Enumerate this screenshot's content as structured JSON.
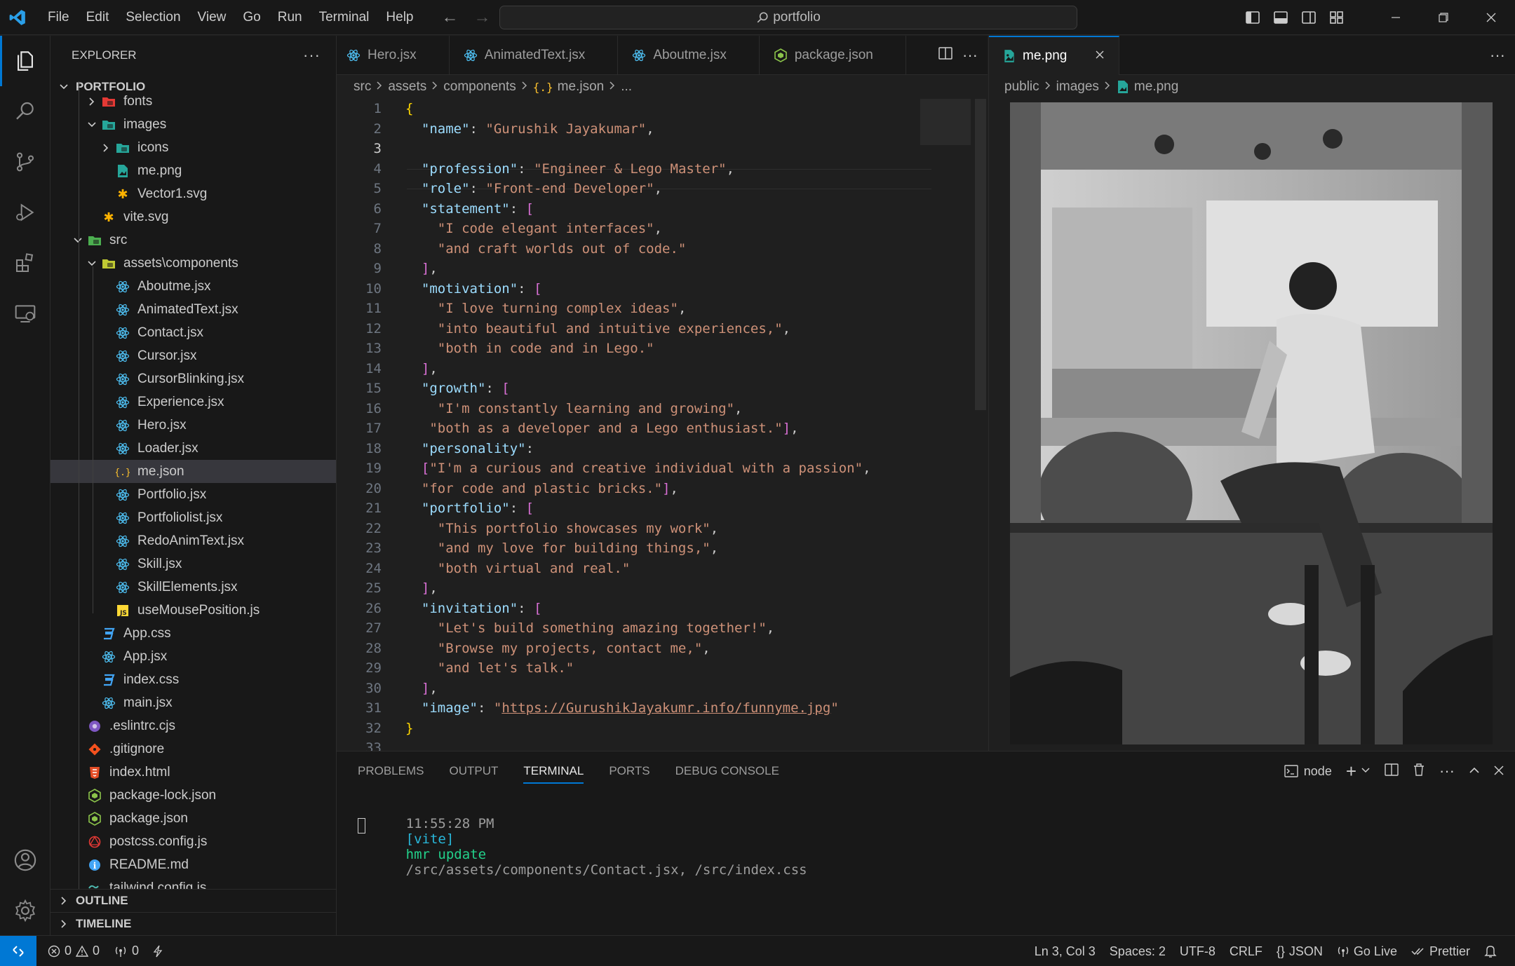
{
  "titlebar": {
    "menu": [
      "File",
      "Edit",
      "Selection",
      "View",
      "Go",
      "Run",
      "Terminal",
      "Help"
    ],
    "search": "portfolio"
  },
  "sidebar": {
    "header": "EXPLORER",
    "root": "PORTFOLIO",
    "items": [
      {
        "label": "fonts",
        "depth": 2,
        "type": "folder",
        "open": false,
        "icon": "folder-fonts-icon",
        "color": "#e53935"
      },
      {
        "label": "images",
        "depth": 2,
        "type": "folder",
        "open": true,
        "icon": "folder-images-icon",
        "color": "#26a69a"
      },
      {
        "label": "icons",
        "depth": 3,
        "type": "folder",
        "open": false,
        "icon": "folder-icons-icon",
        "color": "#26a69a"
      },
      {
        "label": "me.png",
        "depth": 3,
        "type": "file",
        "icon": "image-file-icon",
        "color": "#26a69a"
      },
      {
        "label": "Vector1.svg",
        "depth": 3,
        "type": "file",
        "icon": "svg-file-icon",
        "color": "#ffb300"
      },
      {
        "label": "vite.svg",
        "depth": 2,
        "type": "file",
        "icon": "svg-file-icon",
        "color": "#ffb300"
      },
      {
        "label": "src",
        "depth": 1,
        "type": "folder",
        "open": true,
        "icon": "folder-src-icon",
        "color": "#4caf50"
      },
      {
        "label": "assets\\components",
        "depth": 2,
        "type": "folder",
        "open": true,
        "icon": "folder-components-icon",
        "color": "#c0ca33"
      },
      {
        "label": "Aboutme.jsx",
        "depth": 3,
        "type": "file",
        "icon": "react-icon",
        "color": "#4fc3f7"
      },
      {
        "label": "AnimatedText.jsx",
        "depth": 3,
        "type": "file",
        "icon": "react-icon",
        "color": "#4fc3f7"
      },
      {
        "label": "Contact.jsx",
        "depth": 3,
        "type": "file",
        "icon": "react-icon",
        "color": "#4fc3f7"
      },
      {
        "label": "Cursor.jsx",
        "depth": 3,
        "type": "file",
        "icon": "react-icon",
        "color": "#4fc3f7"
      },
      {
        "label": "CursorBlinking.jsx",
        "depth": 3,
        "type": "file",
        "icon": "react-icon",
        "color": "#4fc3f7"
      },
      {
        "label": "Experience.jsx",
        "depth": 3,
        "type": "file",
        "icon": "react-icon",
        "color": "#4fc3f7"
      },
      {
        "label": "Hero.jsx",
        "depth": 3,
        "type": "file",
        "icon": "react-icon",
        "color": "#4fc3f7"
      },
      {
        "label": "Loader.jsx",
        "depth": 3,
        "type": "file",
        "icon": "react-icon",
        "color": "#4fc3f7"
      },
      {
        "label": "me.json",
        "depth": 3,
        "type": "file",
        "icon": "json-icon",
        "color": "#fbc02d",
        "selected": true
      },
      {
        "label": "Portfolio.jsx",
        "depth": 3,
        "type": "file",
        "icon": "react-icon",
        "color": "#4fc3f7"
      },
      {
        "label": "Portfoliolist.jsx",
        "depth": 3,
        "type": "file",
        "icon": "react-icon",
        "color": "#4fc3f7"
      },
      {
        "label": "RedoAnimText.jsx",
        "depth": 3,
        "type": "file",
        "icon": "react-icon",
        "color": "#4fc3f7"
      },
      {
        "label": "Skill.jsx",
        "depth": 3,
        "type": "file",
        "icon": "react-icon",
        "color": "#4fc3f7"
      },
      {
        "label": "SkillElements.jsx",
        "depth": 3,
        "type": "file",
        "icon": "react-icon",
        "color": "#4fc3f7"
      },
      {
        "label": "useMousePosition.js",
        "depth": 3,
        "type": "file",
        "icon": "js-icon",
        "color": "#fdd835"
      },
      {
        "label": "App.css",
        "depth": 2,
        "type": "file",
        "icon": "css-icon",
        "color": "#42a5f5"
      },
      {
        "label": "App.jsx",
        "depth": 2,
        "type": "file",
        "icon": "react-icon",
        "color": "#4fc3f7"
      },
      {
        "label": "index.css",
        "depth": 2,
        "type": "file",
        "icon": "css-icon",
        "color": "#42a5f5"
      },
      {
        "label": "main.jsx",
        "depth": 2,
        "type": "file",
        "icon": "react-icon",
        "color": "#4fc3f7"
      },
      {
        "label": ".eslintrc.cjs",
        "depth": 1,
        "type": "file",
        "icon": "eslint-icon",
        "color": "#7e57c2"
      },
      {
        "label": ".gitignore",
        "depth": 1,
        "type": "file",
        "icon": "git-icon",
        "color": "#f4511e"
      },
      {
        "label": "index.html",
        "depth": 1,
        "type": "file",
        "icon": "html-icon",
        "color": "#e44d26"
      },
      {
        "label": "package-lock.json",
        "depth": 1,
        "type": "file",
        "icon": "npm-icon",
        "color": "#8bc34a"
      },
      {
        "label": "package.json",
        "depth": 1,
        "type": "file",
        "icon": "npm-icon",
        "color": "#8bc34a"
      },
      {
        "label": "postcss.config.js",
        "depth": 1,
        "type": "file",
        "icon": "postcss-icon",
        "color": "#e53935"
      },
      {
        "label": "README.md",
        "depth": 1,
        "type": "file",
        "icon": "info-icon",
        "color": "#42a5f5"
      },
      {
        "label": "tailwind.config.js",
        "depth": 1,
        "type": "file",
        "icon": "tailwind-icon",
        "color": "#4db6ac"
      }
    ],
    "outline": "OUTLINE",
    "timeline": "TIMELINE"
  },
  "editor1": {
    "tabs": [
      {
        "label": "Hero.jsx",
        "icon": "react-icon",
        "color": "#4fc3f7",
        "active": false
      },
      {
        "label": "AnimatedText.jsx",
        "icon": "react-icon",
        "color": "#4fc3f7",
        "active": false
      },
      {
        "label": "Aboutme.jsx",
        "icon": "react-icon",
        "color": "#4fc3f7",
        "active": false
      },
      {
        "label": "package.json",
        "icon": "npm-icon",
        "color": "#8bc34a",
        "active": false
      }
    ],
    "breadcrumb": [
      "src",
      "assets",
      "components",
      "me.json",
      "..."
    ],
    "current_line": 3,
    "lines": [
      [
        [
          "b1",
          "{"
        ]
      ],
      [
        [
          "p",
          "  "
        ],
        [
          "k",
          "\"name\""
        ],
        [
          "p",
          ": "
        ],
        [
          "s",
          "\"Gurushik Jayakumar\""
        ],
        [
          "p",
          ","
        ]
      ],
      [],
      [
        [
          "p",
          "  "
        ],
        [
          "k",
          "\"profession\""
        ],
        [
          "p",
          ": "
        ],
        [
          "s",
          "\"Engineer & Lego Master\""
        ],
        [
          "p",
          ","
        ]
      ],
      [
        [
          "p",
          "  "
        ],
        [
          "k",
          "\"role\""
        ],
        [
          "p",
          ": "
        ],
        [
          "s",
          "\"Front-end Developer\""
        ],
        [
          "p",
          ","
        ]
      ],
      [
        [
          "p",
          "  "
        ],
        [
          "k",
          "\"statement\""
        ],
        [
          "p",
          ": "
        ],
        [
          "b2",
          "["
        ]
      ],
      [
        [
          "p",
          "    "
        ],
        [
          "s",
          "\"I code elegant interfaces\""
        ],
        [
          "p",
          ","
        ]
      ],
      [
        [
          "p",
          "    "
        ],
        [
          "s",
          "\"and craft worlds out of code.\""
        ]
      ],
      [
        [
          "p",
          "  "
        ],
        [
          "b2",
          "]"
        ],
        [
          "p",
          ","
        ]
      ],
      [
        [
          "p",
          "  "
        ],
        [
          "k",
          "\"motivation\""
        ],
        [
          "p",
          ": "
        ],
        [
          "b2",
          "["
        ]
      ],
      [
        [
          "p",
          "    "
        ],
        [
          "s",
          "\"I love turning complex ideas\""
        ],
        [
          "p",
          ","
        ]
      ],
      [
        [
          "p",
          "    "
        ],
        [
          "s",
          "\"into beautiful and intuitive experiences,\""
        ],
        [
          "p",
          ","
        ]
      ],
      [
        [
          "p",
          "    "
        ],
        [
          "s",
          "\"both in code and in Lego.\""
        ]
      ],
      [
        [
          "p",
          "  "
        ],
        [
          "b2",
          "]"
        ],
        [
          "p",
          ","
        ]
      ],
      [
        [
          "p",
          "  "
        ],
        [
          "k",
          "\"growth\""
        ],
        [
          "p",
          ": "
        ],
        [
          "b2",
          "["
        ]
      ],
      [
        [
          "p",
          "    "
        ],
        [
          "s",
          "\"I'm constantly learning and growing\""
        ],
        [
          "p",
          ","
        ]
      ],
      [
        [
          "p",
          "   "
        ],
        [
          "s",
          "\"both as a developer and a Lego enthusiast.\""
        ],
        [
          "b2",
          "]"
        ],
        [
          "p",
          ","
        ]
      ],
      [
        [
          "p",
          "  "
        ],
        [
          "k",
          "\"personality\""
        ],
        [
          "p",
          ":"
        ]
      ],
      [
        [
          "p",
          "  "
        ],
        [
          "b2",
          "["
        ],
        [
          "s",
          "\"I'm a curious and creative individual with a passion\""
        ],
        [
          "p",
          ","
        ]
      ],
      [
        [
          "p",
          "  "
        ],
        [
          "s",
          "\"for code and plastic bricks.\""
        ],
        [
          "b2",
          "]"
        ],
        [
          "p",
          ","
        ]
      ],
      [
        [
          "p",
          "  "
        ],
        [
          "k",
          "\"portfolio\""
        ],
        [
          "p",
          ": "
        ],
        [
          "b2",
          "["
        ]
      ],
      [
        [
          "p",
          "    "
        ],
        [
          "s",
          "\"This portfolio showcases my work\""
        ],
        [
          "p",
          ","
        ]
      ],
      [
        [
          "p",
          "    "
        ],
        [
          "s",
          "\"and my love for building things,\""
        ],
        [
          "p",
          ","
        ]
      ],
      [
        [
          "p",
          "    "
        ],
        [
          "s",
          "\"both virtual and real.\""
        ]
      ],
      [
        [
          "p",
          "  "
        ],
        [
          "b2",
          "]"
        ],
        [
          "p",
          ","
        ]
      ],
      [
        [
          "p",
          "  "
        ],
        [
          "k",
          "\"invitation\""
        ],
        [
          "p",
          ": "
        ],
        [
          "b2",
          "["
        ]
      ],
      [
        [
          "p",
          "    "
        ],
        [
          "s",
          "\"Let's build something amazing together!\""
        ],
        [
          "p",
          ","
        ]
      ],
      [
        [
          "p",
          "    "
        ],
        [
          "s",
          "\"Browse my projects, contact me,\""
        ],
        [
          "p",
          ","
        ]
      ],
      [
        [
          "p",
          "    "
        ],
        [
          "s",
          "\"and let's talk.\""
        ]
      ],
      [
        [
          "p",
          "  "
        ],
        [
          "b2",
          "]"
        ],
        [
          "p",
          ","
        ]
      ],
      [
        [
          "p",
          "  "
        ],
        [
          "k",
          "\"image\""
        ],
        [
          "p",
          ": "
        ],
        [
          "s",
          "\""
        ],
        [
          "url",
          "https://GurushikJayakumr.info/funnyme.jpg"
        ],
        [
          "s",
          "\""
        ]
      ],
      [
        [
          "b1",
          "}"
        ]
      ],
      []
    ]
  },
  "editor2": {
    "tab": "me.png",
    "breadcrumb": [
      "public",
      "images",
      "me.png"
    ]
  },
  "panel": {
    "tabs": [
      "PROBLEMS",
      "OUTPUT",
      "TERMINAL",
      "PORTS",
      "DEBUG CONSOLE"
    ],
    "active_tab": "TERMINAL",
    "terminal_name": "node",
    "terminal": {
      "time": "11:55:28 PM",
      "tag": "[vite]",
      "cmd": "hmr update",
      "paths": "/src/assets/components/Contact.jsx, /src/index.css"
    }
  },
  "statusbar": {
    "errors": "0",
    "warnings": "0",
    "ports": "0",
    "position": "Ln 3, Col 3",
    "spaces": "Spaces: 2",
    "encoding": "UTF-8",
    "eol": "CRLF",
    "language": "JSON",
    "golive": "Go Live",
    "prettier": "Prettier"
  },
  "colors": {
    "accent": "#0078d4",
    "background": "#1f1f1f",
    "sidebar": "#181818"
  }
}
